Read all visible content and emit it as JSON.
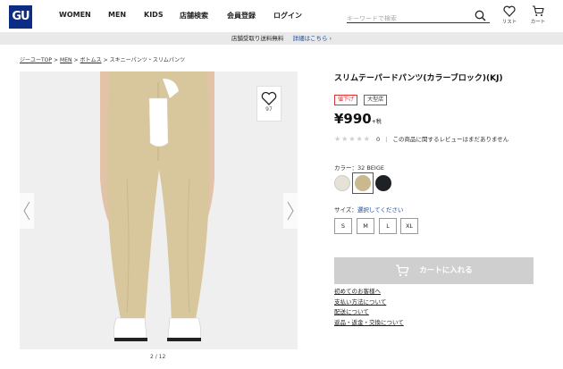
{
  "header": {
    "logo_text": "GU",
    "nav": [
      "WOMEN",
      "MEN",
      "KIDS",
      "店舗検索",
      "会員登録",
      "ログイン"
    ],
    "search_placeholder": "キーワードで検索",
    "icons": [
      {
        "name": "search-icon"
      },
      {
        "name": "heart-icon",
        "label": "リスト"
      },
      {
        "name": "cart-icon",
        "label": "カート"
      }
    ]
  },
  "infobar": {
    "text": "店舗受取り送料無料",
    "link": "詳細はこちら ›"
  },
  "breadcrumb": {
    "items": [
      "ジーユーTOP",
      "MEN",
      "ボトムス",
      "スキニーパンツ・スリムパンツ"
    ],
    "separator": ">"
  },
  "gallery": {
    "favorite_count": "97",
    "counter": "2 / 12",
    "icons": [
      "heart-icon",
      "chevron-left-icon",
      "chevron-right-icon"
    ]
  },
  "product": {
    "title": "スリムテーパードパンツ(カラーブロック)(KJ)",
    "tags": [
      "値下げ",
      "大型店"
    ],
    "price": "¥990",
    "tax_note": "+税",
    "rating_count": "0",
    "review_note": "この商品に関するレビューはまだありません",
    "color_label": "カラー：32 BEIGE",
    "colors": [
      {
        "name": "off-white",
        "hex": "#e6e2d7"
      },
      {
        "name": "beige",
        "hex": "#cab98f",
        "selected": true
      },
      {
        "name": "black",
        "hex": "#1e2125"
      }
    ],
    "size_label": "サイズ：",
    "size_select_text": "選択してください",
    "sizes": [
      "S",
      "M",
      "L",
      "XL"
    ],
    "cart_button": "カートに入れる",
    "links": [
      "初めてのお客様へ",
      "支払い方法について",
      "配送について",
      "返品・返金・交換について"
    ]
  },
  "colors": {
    "brand": "#0c2d83",
    "tag_red": "#d8312f",
    "link_blue": "#1a4aa8",
    "cart_disabled": "#cfcfcf",
    "infobar_bg": "#e9e9e9"
  }
}
